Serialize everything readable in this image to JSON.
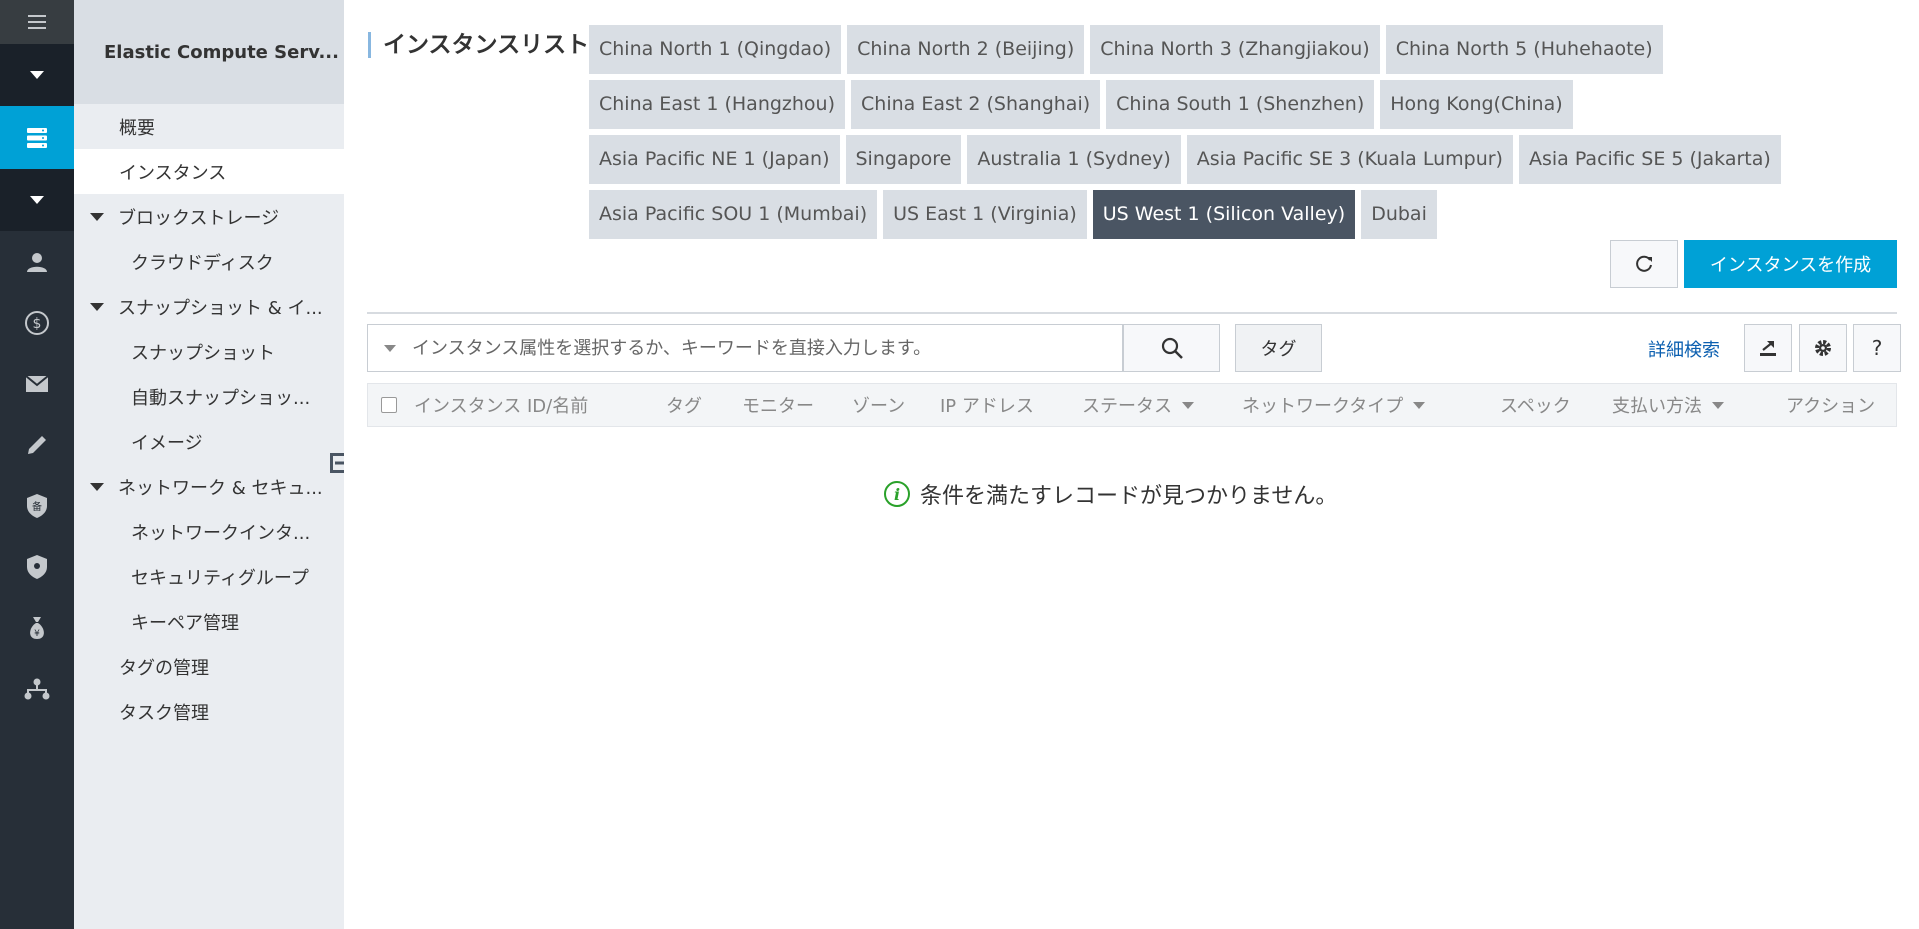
{
  "sidebar": {
    "title": "Elastic Compute Serv...",
    "items": [
      {
        "label": "概要",
        "level": 1
      },
      {
        "label": "インスタンス",
        "level": 1,
        "active": true
      },
      {
        "label": "ブロックストレージ",
        "level": 0,
        "group": true
      },
      {
        "label": "クラウドディスク",
        "level": 2
      },
      {
        "label": "スナップショット & イ...",
        "level": 0,
        "group": true
      },
      {
        "label": "スナップショット",
        "level": 2
      },
      {
        "label": "自動スナップショッ...",
        "level": 2
      },
      {
        "label": "イメージ",
        "level": 2
      },
      {
        "label": "ネットワーク & セキュ...",
        "level": 0,
        "group": true
      },
      {
        "label": "ネットワークインタ...",
        "level": 2
      },
      {
        "label": "セキュリティグループ",
        "level": 2
      },
      {
        "label": "キーペア管理",
        "level": 2
      },
      {
        "label": "タグの管理",
        "level": 1
      },
      {
        "label": "タスク管理",
        "level": 1
      }
    ]
  },
  "rail_icons": [
    "menu-icon",
    "chevron-down-icon",
    "server-icon",
    "chevron-down-icon",
    "user-icon",
    "dollar-icon",
    "mail-icon",
    "pencil-icon",
    "record-shield-icon",
    "security-shield-icon",
    "money-bag-icon",
    "network-tree-icon"
  ],
  "main": {
    "title": "インスタンスリスト",
    "regions": [
      [
        "China North 1 (Qingdao)",
        "China North 2 (Beijing)",
        "China North 3 (Zhangjiakou)",
        "China North 5 (Huhehaote)"
      ],
      [
        "China East 1 (Hangzhou)",
        "China East 2 (Shanghai)",
        "China South 1 (Shenzhen)",
        "Hong Kong(China)"
      ],
      [
        "Asia Pacific NE 1 (Japan)",
        "Singapore",
        "Australia 1 (Sydney)",
        "Asia Pacific SE 3 (Kuala Lumpur)",
        "Asia Pacific SE 5 (Jakarta)"
      ],
      [
        "Asia Pacific SOU 1 (Mumbai)",
        "US East 1 (Virginia)",
        "US West 1 (Silicon Valley)",
        "Dubai"
      ]
    ],
    "selected_region": "US West 1 (Silicon Valley)",
    "create_label": "インスタンスを作成",
    "search_placeholder": "インスタンス属性を選択するか、キーワードを直接入力します。",
    "tag_label": "タグ",
    "advanced_search": "詳細検索",
    "help_label": "?",
    "columns": [
      {
        "label": "インスタンス ID/名前",
        "dropdown": false
      },
      {
        "label": "タグ",
        "dropdown": false
      },
      {
        "label": "モニター",
        "dropdown": false
      },
      {
        "label": "ゾーン",
        "dropdown": false
      },
      {
        "label": "IP アドレス",
        "dropdown": false
      },
      {
        "label": "ステータス",
        "dropdown": true
      },
      {
        "label": "ネットワークタイプ",
        "dropdown": true
      },
      {
        "label": "スペック",
        "dropdown": false
      },
      {
        "label": "支払い方法",
        "dropdown": true
      },
      {
        "label": "アクション",
        "dropdown": false
      }
    ],
    "empty_message": "条件を満たすレコードが見つかりません。"
  },
  "colors": {
    "accent": "#00a1d6",
    "rail": "#272f38",
    "selected_region": "#4a5563",
    "link": "#0b5fb0"
  }
}
